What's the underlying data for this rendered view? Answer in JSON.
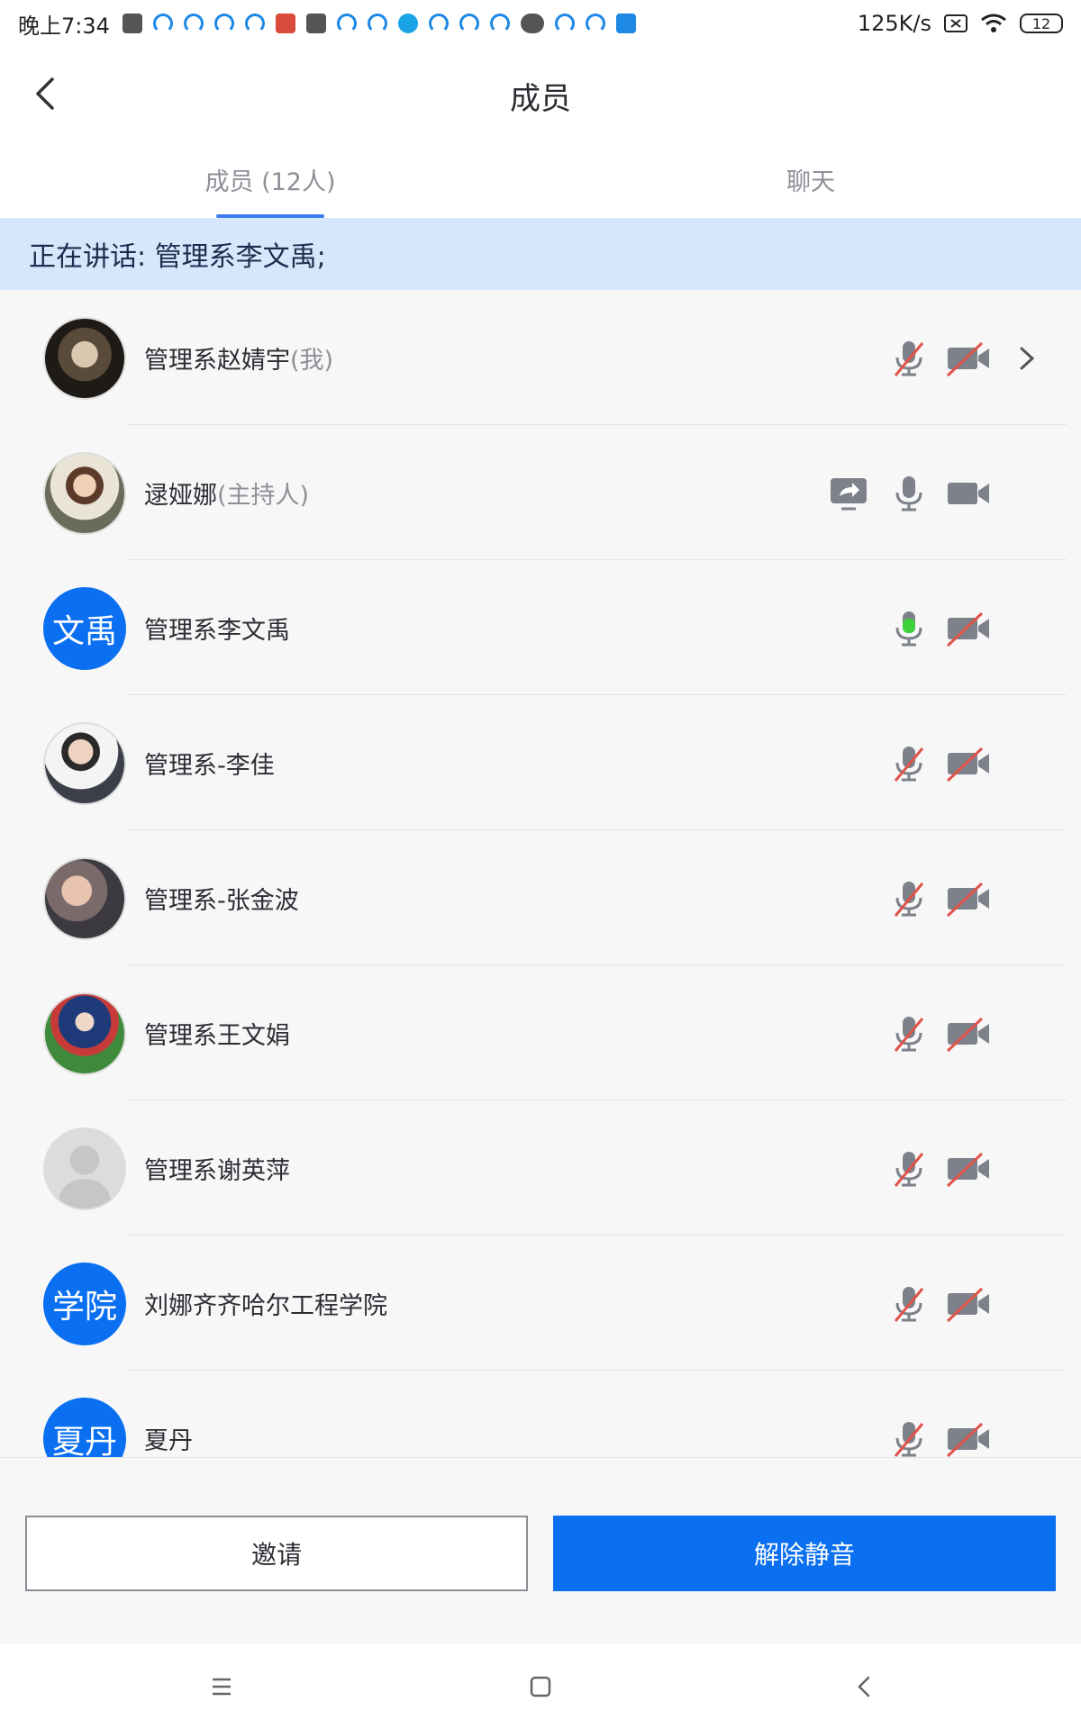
{
  "status_bar": {
    "time": "晚上7:34",
    "net_speed": "125K/s",
    "battery": "12"
  },
  "header": {
    "title": "成员"
  },
  "tabs": [
    {
      "label": "成员 (12人)",
      "active": true
    },
    {
      "label": "聊天",
      "active": false
    }
  ],
  "speaking": {
    "text": "正在讲话: 管理系李文禹;"
  },
  "members": [
    {
      "name": "管理系赵婧宇",
      "suffix": "(我)",
      "avatar": "photo",
      "mic": "muted",
      "camera": "off",
      "chevron": true
    },
    {
      "name": "逯娅娜",
      "suffix": "(主持人)",
      "avatar": "photo",
      "mic": "on",
      "camera": "on",
      "sharing": true
    },
    {
      "name": "管理系李文禹",
      "suffix": "",
      "avatar_text": "文禹",
      "mic": "speaking",
      "camera": "off"
    },
    {
      "name": "管理系-李佳",
      "suffix": "",
      "avatar": "photo",
      "mic": "muted",
      "camera": "off"
    },
    {
      "name": "管理系-张金波",
      "suffix": "",
      "avatar": "photo",
      "mic": "muted",
      "camera": "off"
    },
    {
      "name": "管理系王文娟",
      "suffix": "",
      "avatar": "photo",
      "mic": "muted",
      "camera": "off"
    },
    {
      "name": "管理系谢英萍",
      "suffix": "",
      "avatar": "default",
      "mic": "muted",
      "camera": "off"
    },
    {
      "name": "刘娜齐齐哈尔工程学院",
      "suffix": "",
      "avatar_text": "学院",
      "mic": "muted",
      "camera": "off"
    },
    {
      "name": "夏丹",
      "suffix": "",
      "avatar_text": "夏丹",
      "mic": "muted",
      "camera": "off"
    }
  ],
  "actions": {
    "invite_label": "邀请",
    "unmute_label": "解除静音"
  },
  "colors": {
    "accent": "#0a6ff0",
    "speaking_banner": "#d6e6fb",
    "muted_slash": "#e0534a",
    "speaking_mic": "#3ed13e",
    "icon_gray": "#7d8189"
  }
}
